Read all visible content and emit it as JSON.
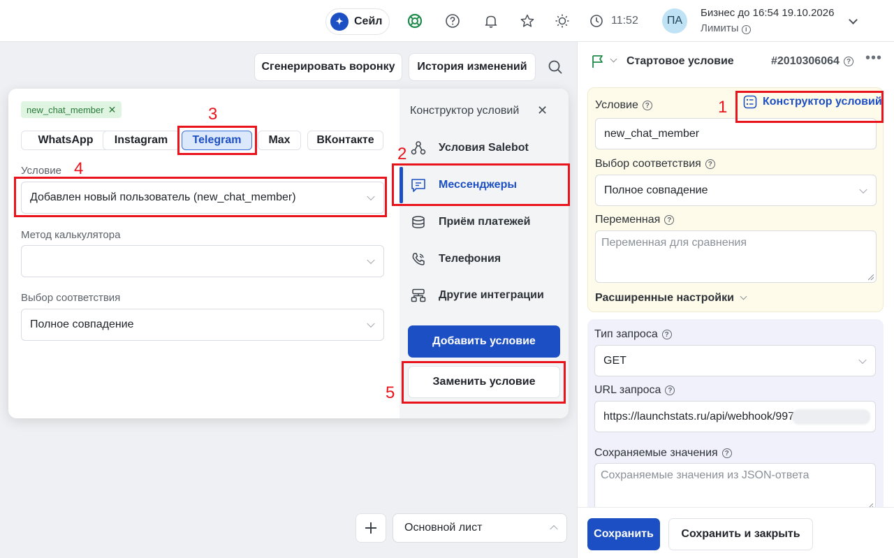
{
  "topbar": {
    "sale_label": "Сейл",
    "time": "11:52",
    "avatar_initials": "ПА",
    "plan": "Бизнес до 16:54 19.10.2026",
    "limits": "Лимиты"
  },
  "toolbar": {
    "generate_funnel": "Сгенерировать воронку",
    "history": "История изменений"
  },
  "popup": {
    "chip": "new_chat_member",
    "tabs": [
      {
        "label": "WhatsApp",
        "active": false
      },
      {
        "label": "Instagram",
        "active": false
      },
      {
        "label": "Telegram",
        "active": true
      },
      {
        "label": "Max",
        "active": false
      },
      {
        "label": "ВКонтакте",
        "active": false
      }
    ],
    "condition_label": "Условие",
    "condition_value": "Добавлен новый пользователь (new_chat_member)",
    "calc_label": "Метод калькулятора",
    "calc_value": "",
    "match_label": "Выбор соответствия",
    "match_value": "Полное совпадение",
    "sidebar_title": "Конструктор условий",
    "menu": [
      {
        "label": "Условия Salebot",
        "icon": "nodes-icon"
      },
      {
        "label": "Мессенджеры",
        "icon": "chat-icon",
        "active": true
      },
      {
        "label": "Приём платежей",
        "icon": "coins-icon"
      },
      {
        "label": "Телефония",
        "icon": "phone-icon"
      },
      {
        "label": "Другие интеграции",
        "icon": "integrations-icon"
      }
    ],
    "add_condition": "Добавить условие",
    "replace_condition": "Заменить условие"
  },
  "annotations": {
    "n1": "1",
    "n2": "2",
    "n3": "3",
    "n4": "4",
    "n5": "5",
    "color": "#e8131b"
  },
  "bottom": {
    "sheet": "Основной лист"
  },
  "panel": {
    "title": "Стартовое условие",
    "id": "#2010306064",
    "condition_label": "Условие",
    "constructor_link": "Конструктор условий",
    "condition_value": "new_chat_member",
    "match_label": "Выбор соответствия",
    "match_value": "Полное совпадение",
    "variable_label": "Переменная",
    "variable_placeholder": "Переменная для сравнения",
    "advanced": "Расширенные настройки",
    "request_type_label": "Тип запроса",
    "request_type_value": "GET",
    "url_label": "URL запроса",
    "url_value": "https://launchstats.ru/api/webhook/9975",
    "saved_label": "Сохраняемые значения",
    "saved_placeholder": "Сохраняемые значения из JSON-ответа",
    "save": "Сохранить",
    "save_close": "Сохранить и закрыть"
  },
  "colors": {
    "accent": "#1d4fc4",
    "chip_bg": "#dff5e2",
    "yellow_block": "#fefbea",
    "purple_block": "#f1f1fb"
  }
}
